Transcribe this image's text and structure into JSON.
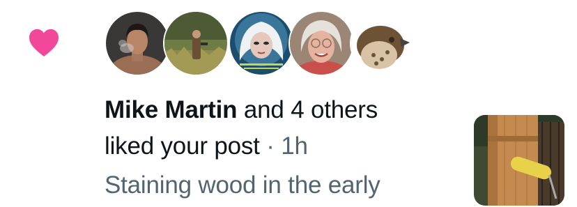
{
  "notification": {
    "type_icon": "heart-icon",
    "accent_color": "#f91880",
    "avatars": [
      {
        "name": "avatar-man-smoking"
      },
      {
        "name": "avatar-person-in-field"
      },
      {
        "name": "avatar-white-haired-woman"
      },
      {
        "name": "avatar-older-woman-glasses"
      },
      {
        "name": "avatar-hawk"
      }
    ],
    "actor_name": "Mike Martin",
    "others_text": " and 4 others",
    "action_text": "liked your post",
    "separator": " · ",
    "time": "1h",
    "post_snippet": "Staining wood in the early",
    "thumbnail": "post-thumbnail-wood-staining"
  }
}
